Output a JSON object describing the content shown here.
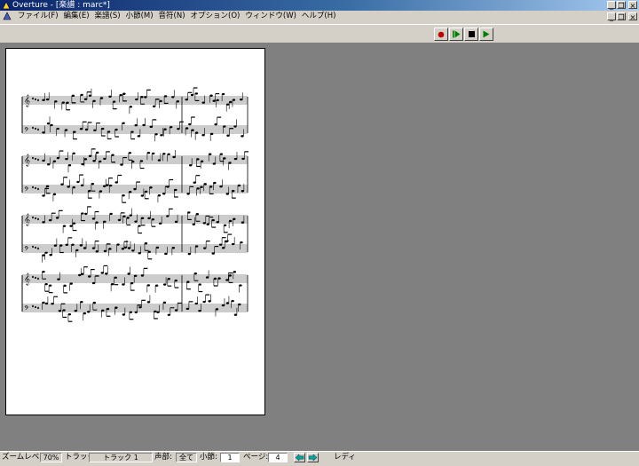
{
  "window": {
    "title": "Overture - [楽譜 : marc*]",
    "controls": {
      "minimize": "_",
      "restore": "❐",
      "close": "×"
    }
  },
  "menu": {
    "items": [
      "ファイル(F)",
      "編集(E)",
      "楽譜(S)",
      "小節(M)",
      "音符(N)",
      "オプション(O)",
      "ウィンドウ(W)",
      "ヘルプ(H)"
    ]
  },
  "transport": {
    "buttons": [
      "record-icon",
      "play-from-start-icon",
      "stop-icon",
      "play-icon"
    ],
    "colors": {
      "record": "#c00000",
      "play": "#008000",
      "stop": "#000000"
    }
  },
  "score": {
    "systems": 4,
    "clefs": [
      "treble",
      "bass"
    ],
    "key_signature": "E-flat major (3 flats)"
  },
  "statusbar": {
    "zoom_label": "ズームレベル:",
    "zoom_value": "70%",
    "track_label": "トラック:",
    "track_value": "トラック 1",
    "voice_label": "声部:",
    "voice_value": "全て",
    "measure_label": "小節:",
    "measure_value": "1",
    "page_label": "ページ:",
    "page_value": "4",
    "status_text": "レディ"
  },
  "colors": {
    "titlebar_start": "#0a246a",
    "titlebar_end": "#a6caf0",
    "face": "#d4d0c8",
    "workspace": "#808080",
    "arrow_accent": "#00a0a0"
  }
}
